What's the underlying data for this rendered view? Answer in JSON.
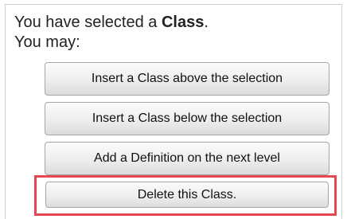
{
  "message": {
    "prefix": "You have selected a ",
    "entity": "Class",
    "suffix": ".",
    "you_may": "You may:"
  },
  "actions": [
    {
      "label": "Insert a Class above the selection"
    },
    {
      "label": "Insert a Class below the selection"
    },
    {
      "label": "Add a Definition on the next level"
    },
    {
      "label": "Delete this Class."
    }
  ],
  "colors": {
    "highlight_border": "#e8474f",
    "panel_border": "#cfcfcf",
    "text": "#222222"
  }
}
